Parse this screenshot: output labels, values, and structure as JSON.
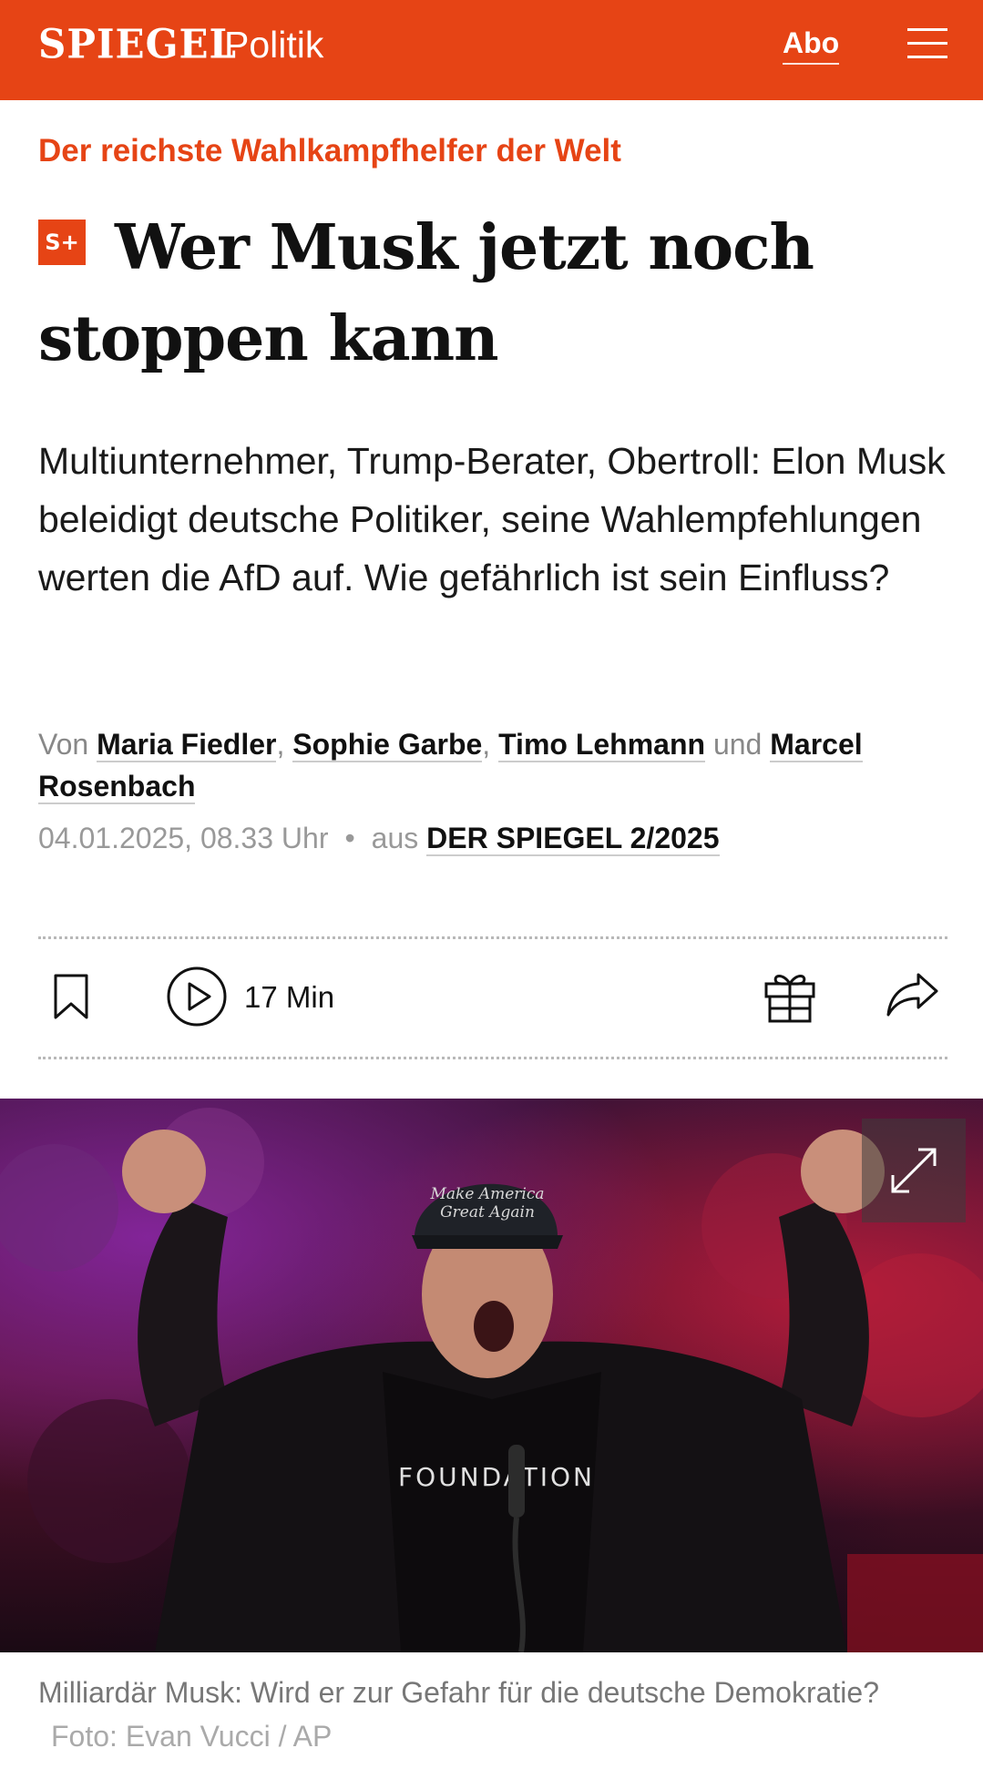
{
  "header": {
    "logo": "SPIEGEL",
    "section": "Politik",
    "abo_label": "Abo",
    "menu_icon": "hamburger-menu-icon",
    "background_color": "#e64415"
  },
  "article": {
    "kicker": "Der reichste Wahlkampfhelfer der Welt",
    "badge": "S+",
    "title": "Wer Musk jetzt noch stoppen kann",
    "teaser": "Multiunternehmer, Trump-Berater, Obertroll: Elon Musk beleidigt deutsche Politiker, seine Wahlempfehlungen werten die AfD auf. Wie gefährlich ist sein Einfluss?",
    "byline_prefix": "Von",
    "authors": [
      "Maria Fiedler",
      "Sophie Garbe",
      "Timo Lehmann",
      "Marcel Rosenbach"
    ],
    "separator_comma": ",",
    "separator_and": "und",
    "date": "04.01.2025, 08.33 Uhr",
    "bullet": "•",
    "source_prefix": "aus",
    "source": "DER SPIEGEL 2/2025"
  },
  "actions": {
    "bookmark_icon": "bookmark-icon",
    "play_icon": "play-icon",
    "duration": "17 Min",
    "gift_icon": "gift-icon",
    "share_icon": "share-icon"
  },
  "image": {
    "expand_icon": "expand-icon",
    "caption": "Milliardär Musk: Wird er zur Gefahr für die deutsche Demokratie?",
    "credit": "Foto: Evan Vucci / AP",
    "shirt_text": "FOUNDATION",
    "cap_text": "Make America Great Again"
  },
  "colors": {
    "accent": "#e64415",
    "text": "#111111",
    "muted": "#888888"
  }
}
